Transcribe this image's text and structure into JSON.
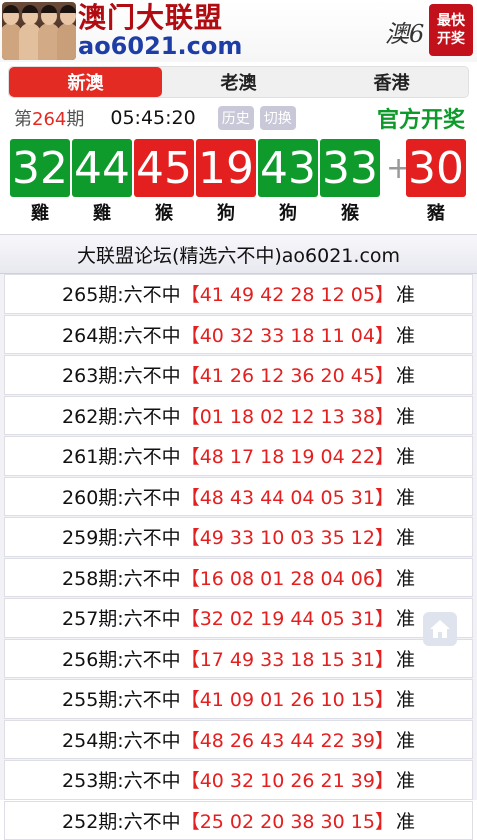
{
  "header": {
    "title": "澳门大联盟",
    "domain": "ao6021.com",
    "mark": "澳6",
    "badge": "最快开奖"
  },
  "tabs": [
    {
      "label": "新澳",
      "active": true
    },
    {
      "label": "老澳",
      "active": false
    },
    {
      "label": "香港",
      "active": false
    }
  ],
  "draw": {
    "issue_prefix": "第",
    "issue": "264",
    "issue_suffix": "期",
    "time": "05:45:20",
    "history_label": "历史",
    "switch_label": "切换",
    "official_label": "官方开奖",
    "plus": "+",
    "balls": [
      {
        "num": "32",
        "zodiac": "雞",
        "color": "green"
      },
      {
        "num": "44",
        "zodiac": "雞",
        "color": "green"
      },
      {
        "num": "45",
        "zodiac": "猴",
        "color": "red"
      },
      {
        "num": "19",
        "zodiac": "狗",
        "color": "red"
      },
      {
        "num": "43",
        "zodiac": "狗",
        "color": "green"
      },
      {
        "num": "33",
        "zodiac": "猴",
        "color": "green"
      }
    ],
    "special": {
      "num": "30",
      "zodiac": "豬",
      "color": "red"
    }
  },
  "colors": {
    "green": "#0f9a2c",
    "red": "#e41f1f",
    "tab_active": "#e32a23",
    "official": "#0e9a2a"
  },
  "forum": {
    "title": "大联盟论坛(精选六不中)ao6021.com",
    "rows": [
      {
        "label": "265期:六不中",
        "nums": "【41 49 42 28 12 05】",
        "result": "准"
      },
      {
        "label": "264期:六不中",
        "nums": "【40 32 33 18 11 04】",
        "result": "准"
      },
      {
        "label": "263期:六不中",
        "nums": "【41 26 12 36 20 45】",
        "result": "准"
      },
      {
        "label": "262期:六不中",
        "nums": "【01 18 02 12 13 38】",
        "result": "准"
      },
      {
        "label": "261期:六不中",
        "nums": "【48 17 18 19 04 22】",
        "result": "准"
      },
      {
        "label": "260期:六不中",
        "nums": "【48 43 44 04 05 31】",
        "result": "准"
      },
      {
        "label": "259期:六不中",
        "nums": "【49 33 10 03 35 12】",
        "result": "准"
      },
      {
        "label": "258期:六不中",
        "nums": "【16 08 01 28 04 06】",
        "result": "准"
      },
      {
        "label": "257期:六不中",
        "nums": "【32 02 19 44 05 31】",
        "result": "准"
      },
      {
        "label": "256期:六不中",
        "nums": "【17 49 33 18 15 31】",
        "result": "准"
      },
      {
        "label": "255期:六不中",
        "nums": "【41 09 01 26 10 15】",
        "result": "准"
      },
      {
        "label": "254期:六不中",
        "nums": "【48 26 43 44 22 39】",
        "result": "准"
      },
      {
        "label": "253期:六不中",
        "nums": "【40 32 10 26 21 39】",
        "result": "准"
      },
      {
        "label": "252期:六不中",
        "nums": "【25 02 20 38 30 15】",
        "result": "准"
      }
    ]
  },
  "icons": {
    "home": "home-icon"
  }
}
